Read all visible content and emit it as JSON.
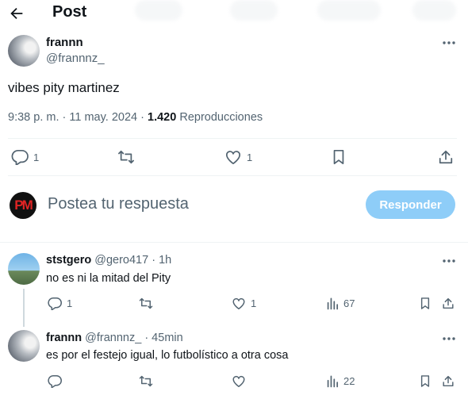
{
  "header": {
    "title": "Post"
  },
  "post": {
    "author_name": "frannn",
    "author_handle": "@frannnz_",
    "text": "vibes pity martinez",
    "time": "9:38 p. m.",
    "separator": "·",
    "date": "11 may. 2024",
    "views_count": "1.420",
    "views_label": "Reproducciones",
    "stats": {
      "replies": "1",
      "likes": "1"
    }
  },
  "composer": {
    "avatar_text": "PM",
    "placeholder": "Postea tu respuesta",
    "button_label": "Responder"
  },
  "replies": [
    {
      "name": "ststgero",
      "handle": "@gero417",
      "time": "· 1h",
      "text": "no es ni la mitad del Pity",
      "replies": "1",
      "likes": "1",
      "views": "67"
    },
    {
      "name": "frannn",
      "handle": "@frannnz_",
      "time": "· 45min",
      "text": "es por el festejo igual, lo futbolístico a otra cosa",
      "views": "22"
    }
  ],
  "colors": {
    "accent": "#1d9bf0",
    "button_disabled": "#8ecdf8",
    "muted": "#536471"
  },
  "icons": [
    "back-arrow-icon",
    "more-icon",
    "reply-icon",
    "repost-icon",
    "like-icon",
    "bookmark-icon",
    "share-icon",
    "views-icon"
  ]
}
